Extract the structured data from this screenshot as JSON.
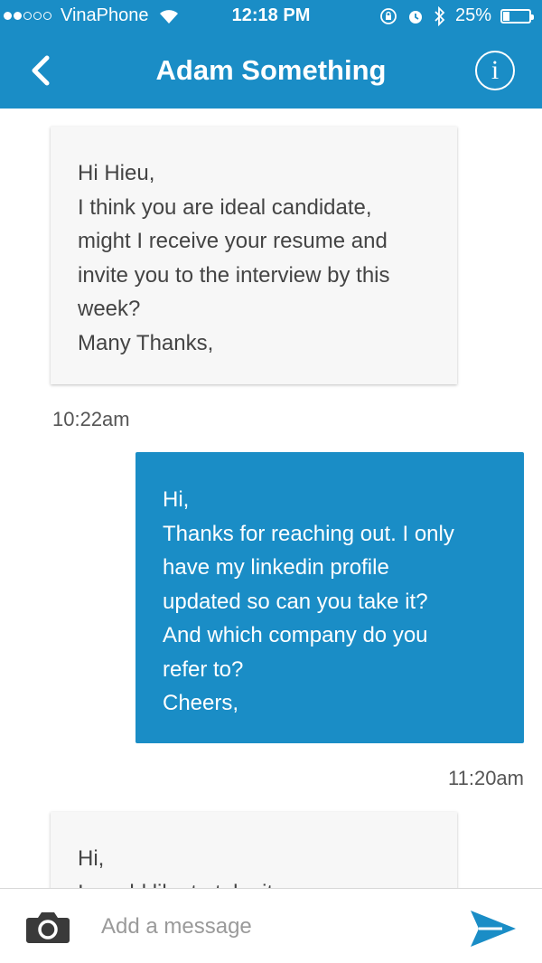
{
  "status_bar": {
    "carrier": "VinaPhone",
    "time": "12:18 PM",
    "battery_percent": "25%",
    "battery_level": 0.25,
    "signal_bars_filled": 2,
    "signal_bars_total": 5,
    "icons": [
      "wifi-icon",
      "rotation-lock-icon",
      "alarm-icon",
      "bluetooth-icon",
      "battery-icon"
    ]
  },
  "header": {
    "title": "Adam Something",
    "back_icon": "chevron-left-icon",
    "info_label": "i"
  },
  "messages": [
    {
      "direction": "incoming",
      "lines": [
        "Hi Hieu,",
        "I think you are ideal candidate,",
        "might I receive your resume and",
        "invite you to the interview by this",
        "week?",
        "Many Thanks,"
      ],
      "time": "10:22am"
    },
    {
      "direction": "outgoing",
      "lines": [
        "Hi,",
        "Thanks for reaching out. I only",
        "have my linkedin profile",
        "updated so can you take it?",
        "And which company do you",
        "refer to?",
        "Cheers,"
      ],
      "time": "11:20am"
    },
    {
      "direction": "incoming",
      "lines": [
        "Hi,",
        "I would like to take it as your"
      ],
      "time": ""
    }
  ],
  "composer": {
    "placeholder": "Add a message",
    "value": "",
    "camera_icon": "camera-icon",
    "send_icon": "send-icon"
  },
  "colors": {
    "accent": "#1a8dc6",
    "incoming_bubble": "#f7f7f7",
    "incoming_text": "#444444",
    "timestamp": "#555555"
  }
}
